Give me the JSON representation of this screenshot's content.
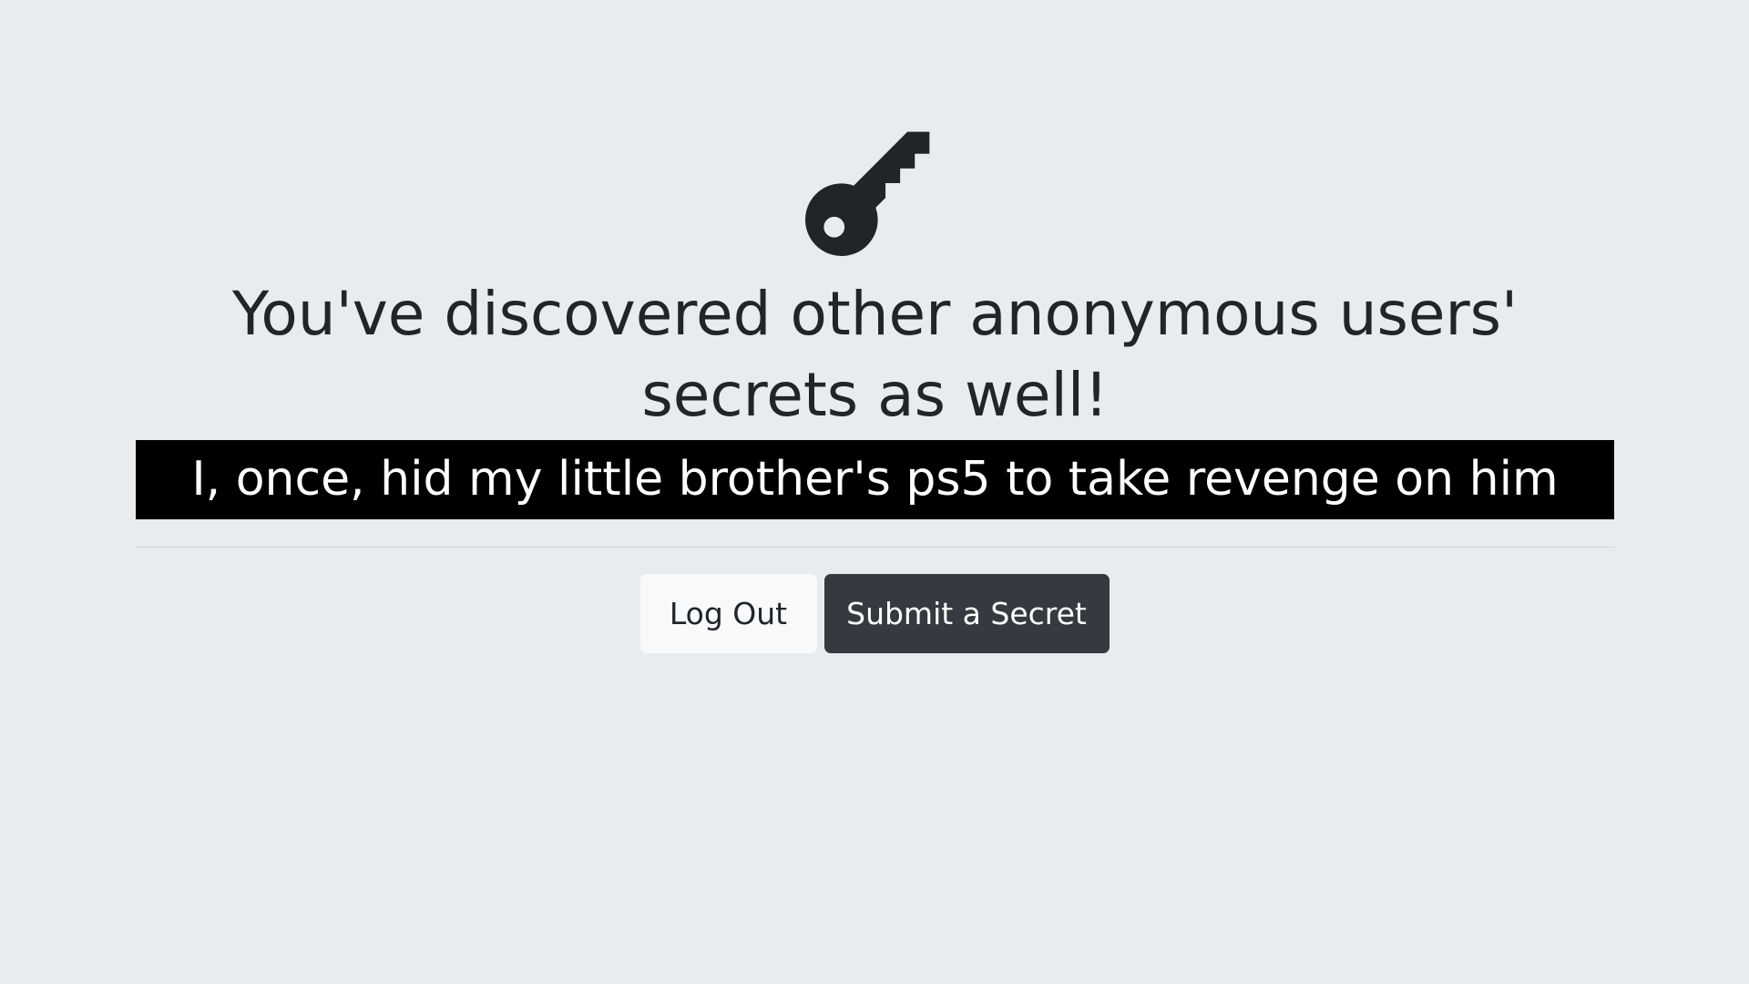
{
  "header": {
    "icon": "key-icon",
    "title": "You've discovered other anonymous users' secrets as well!"
  },
  "secrets": [
    {
      "text": "I, once, hid my little brother's ps5 to take revenge on him"
    }
  ],
  "actions": {
    "logout_label": "Log Out",
    "submit_label": "Submit a Secret"
  },
  "colors": {
    "background": "#e8ecef",
    "text": "#212529",
    "secret_background": "#000000",
    "secret_text": "#ffffff",
    "logout_button": "#f8f9fa",
    "submit_button": "#343a40"
  }
}
